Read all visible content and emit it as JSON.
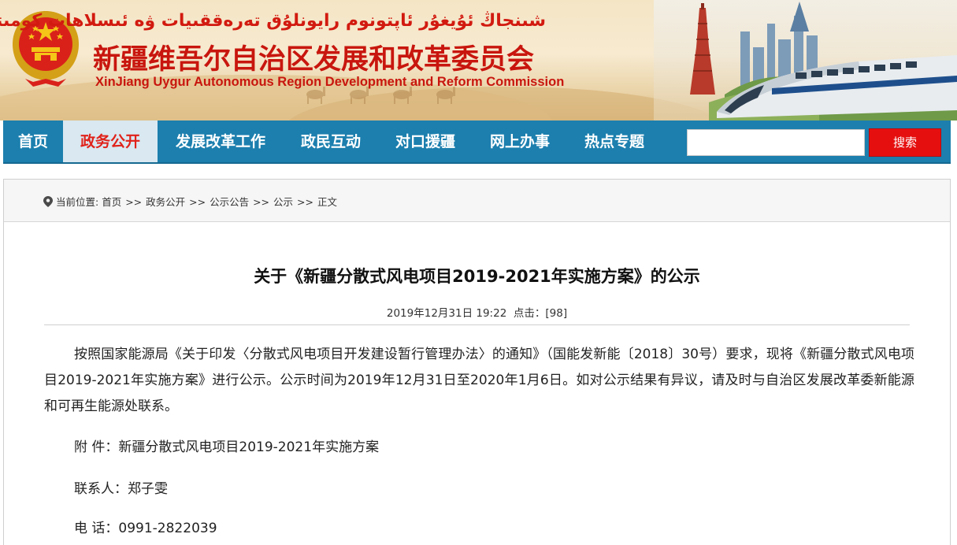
{
  "header": {
    "uyghur_title": "شىنجاڭ ئۇيغۇر ئاپتونوم رايونلۇق تەرەققىيات ۋە ئىسلاھات كومىتېتى",
    "cn_title": "新疆维吾尔自治区发展和改革委员会",
    "en_title": "XinJiang Uygur Autonomous Region Development and Reform Commission"
  },
  "nav": {
    "items": [
      {
        "label": "首页"
      },
      {
        "label": "政务公开"
      },
      {
        "label": "发展改革工作"
      },
      {
        "label": "政民互动"
      },
      {
        "label": "对口援疆"
      },
      {
        "label": "网上办事"
      },
      {
        "label": "热点专题"
      }
    ],
    "active_index": 1,
    "search_placeholder": "",
    "search_button": "搜索"
  },
  "breadcrumb": {
    "prefix": "当前位置:",
    "items": [
      "首页",
      "政务公开",
      "公示公告",
      "公示",
      "正文"
    ],
    "separator": ">>"
  },
  "article": {
    "title": "关于《新疆分散式风电项目2019-2021年实施方案》的公示",
    "date": "2019年12月31日 19:22",
    "clicks_label": "点击：",
    "clicks_value": "[98]",
    "body": "按照国家能源局《关于印发〈分散式风电项目开发建设暂行管理办法〉的通知》（国能发新能〔2018〕30号）要求，现将《新疆分散式风电项目2019-2021年实施方案》进行公示。公示时间为2019年12月31日至2020年1月6日。如对公示结果有异议，请及时与自治区发展改革委新能源和可再生能源处联系。",
    "attachment_label": "附 件：",
    "attachment_value": "新疆分散式风电项目2019-2021年实施方案",
    "contact_label": "联系人：",
    "contact_value": "郑子雯",
    "phone_label": "电 话：",
    "phone_value": "0991-2822039"
  },
  "colors": {
    "brand_red": "#c8160e",
    "nav_blue": "#1c7fae",
    "nav_active_bg": "#d9e8f1",
    "nav_active_text": "#e0221a",
    "search_red": "#e60f0f"
  },
  "icons": {
    "emblem": "national-emblem-icon",
    "location": "location-pin-icon"
  }
}
